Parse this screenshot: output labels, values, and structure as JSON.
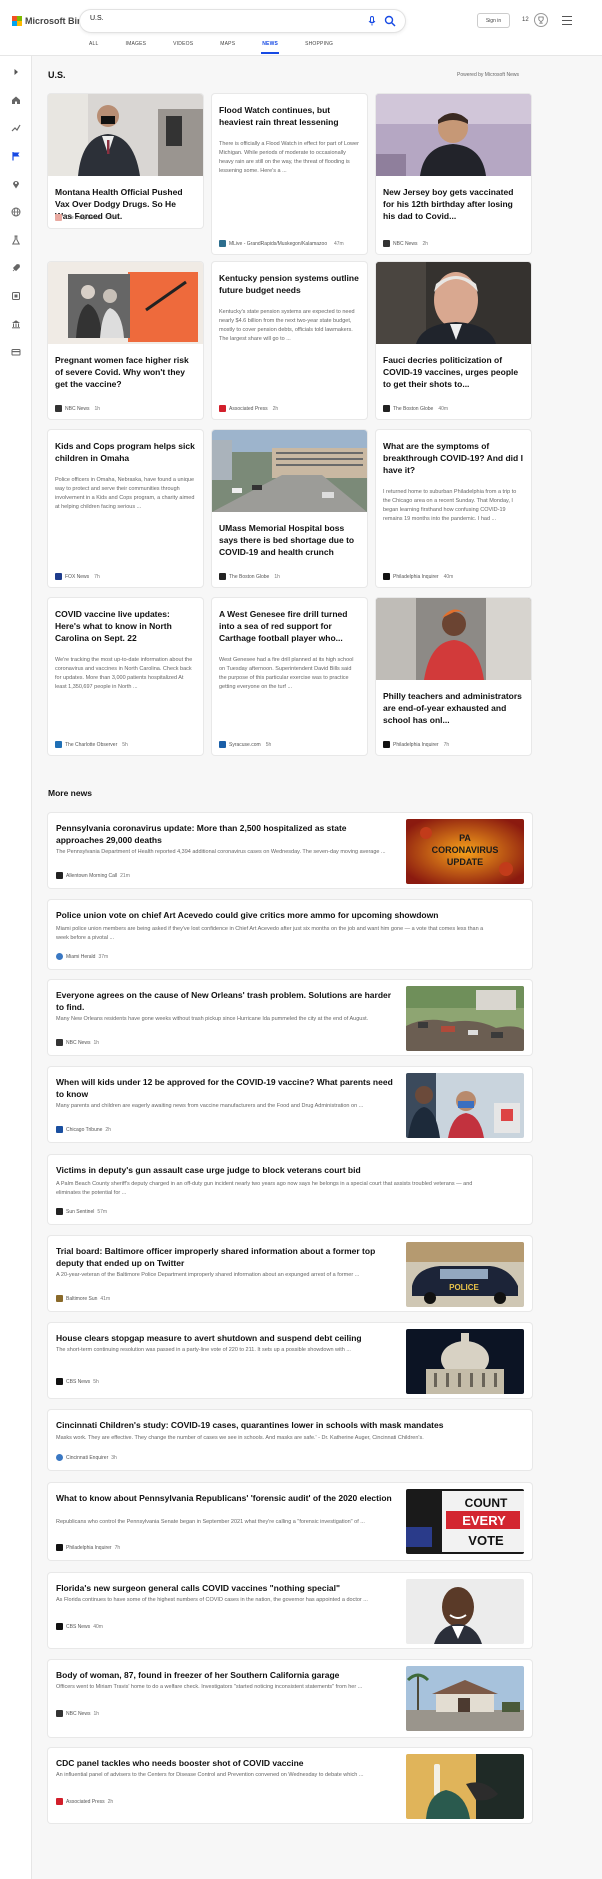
{
  "brand": {
    "name": "Microsoft Bing"
  },
  "search": {
    "value": "U.S."
  },
  "header": {
    "signin_label": "Sign in",
    "rewards_count": "12"
  },
  "tabs": [
    "ALL",
    "IMAGES",
    "VIDEOS",
    "MAPS",
    "NEWS",
    "SHOPPING"
  ],
  "section": {
    "title": "U.S.",
    "powered_by": "Powered by Microsoft News"
  },
  "cards": [
    {
      "title": "Montana Health Official Pushed Vax Over Dodgy Drugs. So He Was Forced Out.",
      "snippet": "",
      "source": "The Daily Beast",
      "ago": "47m",
      "color": "#e05a4a"
    },
    {
      "title": "Flood Watch continues, but heaviest rain threat lessening",
      "snippet": "There is officially a Flood Watch in effect for part of Lower Michigan. While periods of moderate to occasionally heavy rain are still on the way, the threat of flooding is lessening some. Here's a ...",
      "source": "MLive - GrandRapids/Muskegon/Kalamazoo",
      "ago": "47m",
      "color": "#2d6e8e"
    },
    {
      "title": "New Jersey boy gets vaccinated for his 12th birthday after losing his dad to Covid...",
      "snippet": "",
      "source": "NBC News",
      "ago": "2h",
      "color": "#333333"
    },
    {
      "title": "Pregnant women face higher risk of severe Covid. Why won't they get the vaccine?",
      "snippet": "",
      "source": "NBC News",
      "ago": "1h",
      "color": "#333333"
    },
    {
      "title": "Kentucky pension systems outline future budget needs",
      "snippet": "Kentucky's state pension systems are expected to need nearly $4.6 billion from the next two-year state budget, mostly to cover pension debts, officials told lawmakers. The largest share will go to ...",
      "source": "Associated Press",
      "ago": "2h",
      "color": "#d21f2b"
    },
    {
      "title": "Fauci decries politicization of COVID-19 vaccines, urges people to get their shots to...",
      "snippet": "",
      "source": "The Boston Globe",
      "ago": "40m",
      "color": "#222222"
    },
    {
      "title": "Kids and Cops program helps sick children in Omaha",
      "snippet": "Police officers in Omaha, Nebraska, have found a unique way to protect and serve their communities through involvement in a Kids and Cops program, a charity aimed at helping children facing serious ...",
      "source": "FOX News",
      "ago": "7h",
      "color": "#1e3c8c"
    },
    {
      "title": "UMass Memorial Hospital boss says there is bed shortage due to COVID-19 and health crunch",
      "snippet": "",
      "source": "The Boston Globe",
      "ago": "1h",
      "color": "#222222"
    },
    {
      "title": "What are the symptoms of breakthrough COVID-19? And did I have it?",
      "snippet": "I returned home to suburban Philadelphia from a trip to the Chicago area on a recent Sunday. That Monday, I began learning firsthand how confusing COVID-19 remains 19 months into the pandemic. I had ...",
      "source": "Philadelphia Inquirer",
      "ago": "40m",
      "color": "#111111"
    },
    {
      "title": "COVID vaccine live updates: Here's what to know in North Carolina on Sept. 22",
      "snippet": "We're tracking the most up-to-date information about the coronavirus and vaccines in North Carolina. Check back for updates. More than 3,000 patients hospitalized At least 1,350,697 people in North ...",
      "source": "The Charlotte Observer",
      "ago": "5h",
      "color": "#1f6fb5"
    },
    {
      "title": "A West Genesee fire drill turned into a sea of red support for Carthage football player who...",
      "snippet": "West Genesee had a fire drill planned at its high school on Tuesday afternoon. Superintendent David Bills said the purpose of this particular exercise was to practice getting everyone on the turf ...",
      "source": "Syracuse.com",
      "ago": "5h",
      "color": "#1a5fa8"
    },
    {
      "title": "Philly teachers and administrators are end-of-year exhausted and school has onl...",
      "snippet": "",
      "source": "Philadelphia Inquirer",
      "ago": "7h",
      "color": "#111111"
    }
  ],
  "more_news": {
    "title": "More news",
    "items": [
      {
        "title": "Pennsylvania coronavirus update: More than 2,500 hospitalized as state approaches 29,000 deaths",
        "snippet": "The Pennsylvania Department of Health reported 4,394 additional coronavirus cases on Wednesday. The seven-day moving average ...",
        "source": "Allentown Morning Call",
        "ago": "21m",
        "thumb_text": "PA CORONAVIRUS UPDATE",
        "color": "#222222"
      },
      {
        "title": "Police union vote on chief Art Acevedo could give critics more ammo for upcoming showdown",
        "snippet": "Miami police union members are being asked if they've lost confidence in Chief Art Acevedo after just six months on the job and want him gone — a vote that comes less than a week before a pivotal ...",
        "source": "Miami Herald",
        "ago": "37m",
        "color": "#3a78c3"
      },
      {
        "title": "Everyone agrees on the cause of New Orleans' trash problem. Solutions are harder to find.",
        "snippet": "Many New Orleans residents have gone weeks without trash pickup since Hurricane Ida pummeled the city at the end of August.",
        "source": "NBC News",
        "ago": "1h",
        "color": "#333333"
      },
      {
        "title": "When will kids under 12 be approved for the COVID-19 vaccine? What parents need to know",
        "snippet": "Many parents and children are eagerly awaiting news from vaccine manufacturers and the Food and Drug Administration on ...",
        "source": "Chicago Tribune",
        "ago": "2h",
        "color": "#1a4fa0"
      },
      {
        "title": "Victims in deputy's gun assault case urge judge to block veterans court bid",
        "snippet": "A Palm Beach County sheriff's deputy charged in an off-duty gun incident nearly two years ago now says he belongs in a special court that assists troubled veterans — and eliminates the potential for ...",
        "source": "Sun Sentinel",
        "ago": "57m",
        "color": "#222222"
      },
      {
        "title": "Trial board: Baltimore officer improperly shared information about a former top deputy that ended up on Twitter",
        "snippet": "A 20-year-veteran of the Baltimore Police Department improperly shared information about an expunged arrest of a former ...",
        "source": "Baltimore Sun",
        "ago": "41m",
        "thumb_text": "POLICE",
        "color": "#8a6a2a"
      },
      {
        "title": "House clears stopgap measure to avert shutdown and suspend debt ceiling",
        "snippet": "The short-term continuing resolution was passed in a party-line vote of 220 to 211. It sets up a possible showdown with ...",
        "source": "CBS News",
        "ago": "5h",
        "color": "#111111"
      },
      {
        "title": "Cincinnati Children's study: COVID-19 cases, quarantines lower in schools with mask mandates",
        "snippet": "Masks work. They are effective. They change the number of cases we see in schools. And masks are safe.' - Dr. Katherine Auger, Cincinnati Children's.",
        "source": "Cincinnati Enquirer",
        "ago": "3h",
        "color": "#3a78c3"
      },
      {
        "title": "What to know about Pennsylvania Republicans' 'forensic audit' of the 2020 election",
        "snippet": "Republicans who control the Pennsylvania Senate began in September 2021 what they're calling a \"forensic investigation\" of ...",
        "source": "Philadelphia Inquirer",
        "ago": "7h",
        "thumb_text": "COUNT EVERY VOTE",
        "color": "#111111"
      },
      {
        "title": "Florida's new surgeon general calls COVID vaccines \"nothing special\"",
        "snippet": "As Florida continues to have some of the highest numbers of COVID cases in the nation, the governor has appointed a doctor ...",
        "source": "CBS News",
        "ago": "40m",
        "color": "#111111"
      },
      {
        "title": "Body of woman, 87, found in freezer of her Southern California garage",
        "snippet": "Officers went to Miriam Travis' home to do a welfare check. Investigators \"started noticing inconsistent statements\" from her ...",
        "source": "NBC News",
        "ago": "1h",
        "color": "#333333"
      },
      {
        "title": "CDC panel tackles who needs booster shot of COVID vaccine",
        "snippet": "An influential panel of advisers to the Centers for Disease Control and Prevention convened on Wednesday to debate which ...",
        "source": "Associated Press",
        "ago": "2h",
        "color": "#d21f2b"
      }
    ]
  }
}
